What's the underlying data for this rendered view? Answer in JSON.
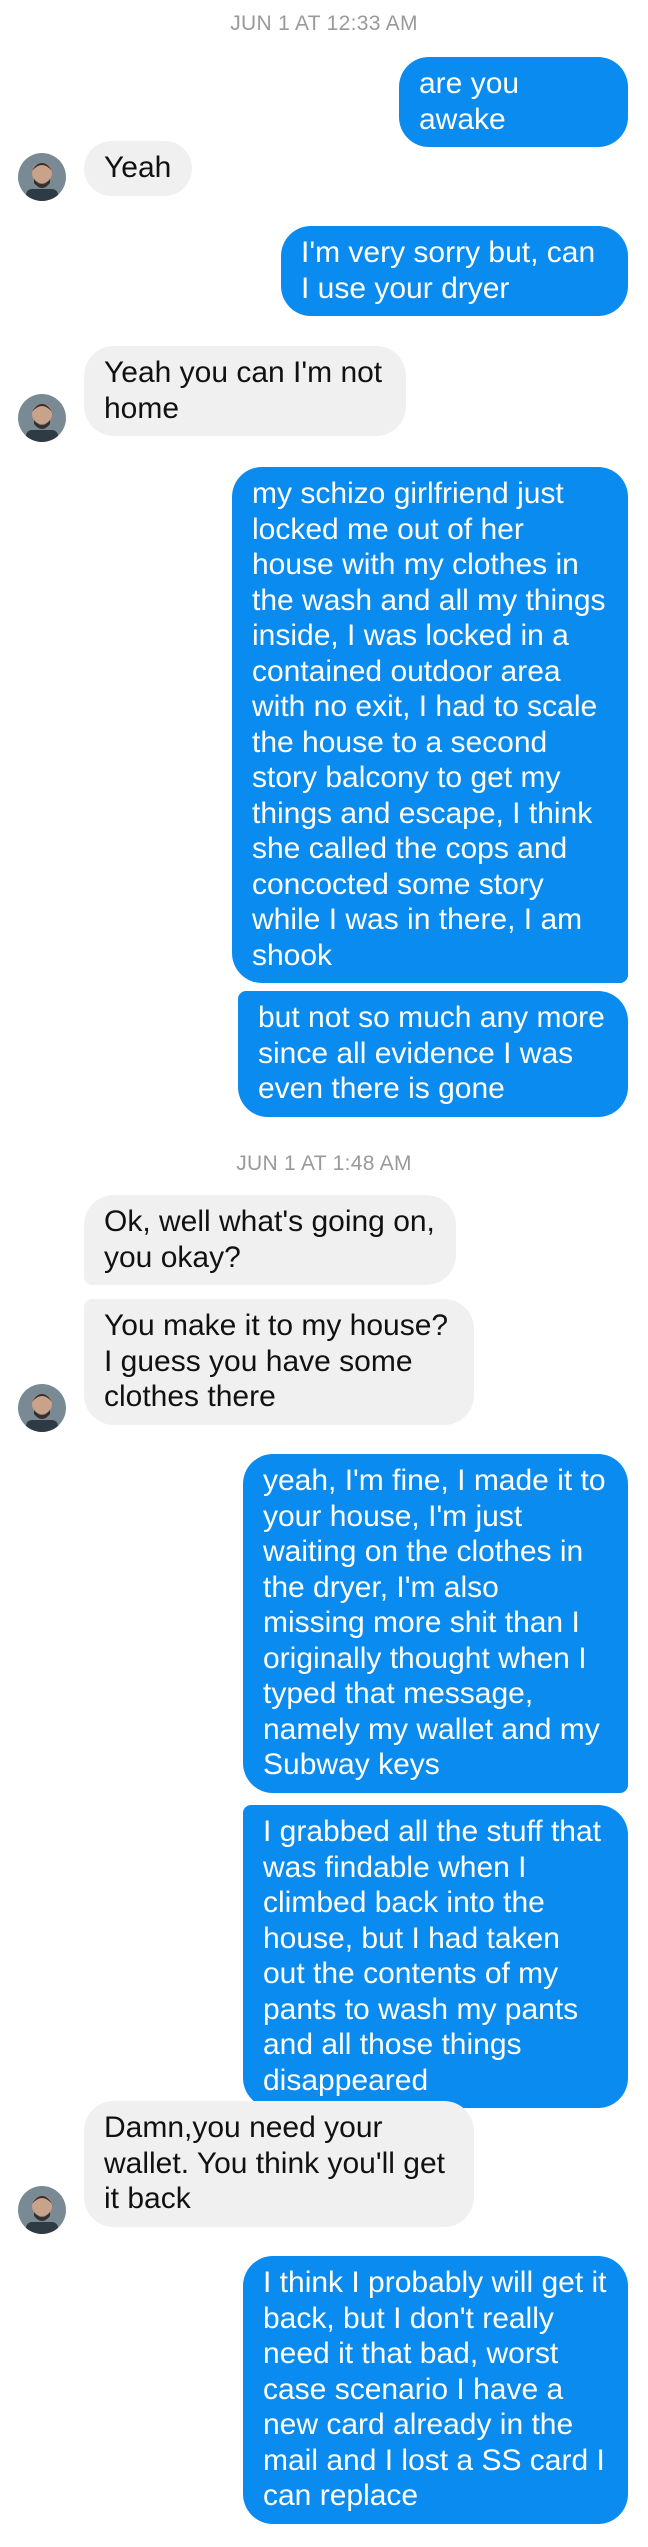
{
  "timestamps": {
    "t1": "JUN 1 AT 12:33 AM",
    "t2": "JUN 1 AT 1:48 AM"
  },
  "messages": [
    {
      "from": "me",
      "text": "are you awake"
    },
    {
      "from": "contact",
      "text": "Yeah"
    },
    {
      "from": "me",
      "text": "I'm very sorry but, can I use your dryer"
    },
    {
      "from": "contact",
      "text": "Yeah you can I'm not home"
    },
    {
      "from": "me",
      "text": "my schizo girlfriend just locked me out of her house with my clothes in the wash and all my things inside, I was locked in a contained outdoor area with no exit, I had to scale the house to a second story balcony to get my things and escape, I think she called the cops and concocted some story while I was in there, I am shook"
    },
    {
      "from": "me",
      "text": "but not so much any more since all evidence I was even there is gone"
    },
    {
      "from": "contact",
      "text": "Ok, well what's going on, you okay?"
    },
    {
      "from": "contact",
      "text": "You make it to my house? I guess you have some clothes there"
    },
    {
      "from": "me",
      "text": "yeah, I'm fine, I made it to your house, I'm just waiting on the clothes in the dryer, I'm also missing more shit than I originally thought when I typed that message, namely my wallet and my Subway keys"
    },
    {
      "from": "me",
      "text": "I grabbed all the stuff that was findable when I climbed back into the house, but I had taken out the contents of my pants to wash my pants and all those things disappeared"
    },
    {
      "from": "contact",
      "text": "Damn,you need your wallet. You think you'll get it back"
    },
    {
      "from": "me",
      "text": "I think I probably will get it back, but I don't really need it that bad, worst case scenario I have a new card already in the mail and I lost a SS card I can replace"
    }
  ],
  "colors": {
    "sent_bubble": "#0a8bf0",
    "received_bubble": "#f0f0f0",
    "timestamp": "#9a9a9a"
  },
  "icons": {
    "avatar": "contact-avatar-photo"
  }
}
